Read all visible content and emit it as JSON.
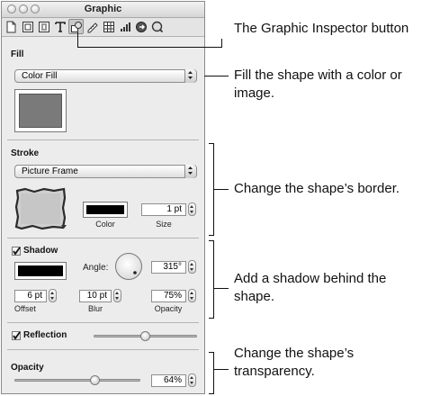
{
  "window": {
    "title": "Graphic",
    "toolbar_icons": [
      "document-icon",
      "layout-icon",
      "wrap-icon",
      "text-icon",
      "graphic-icon",
      "metrics-icon",
      "table-icon",
      "chart-icon",
      "hyperlink-icon",
      "quicktime-icon"
    ],
    "selected_tool": "graphic-icon"
  },
  "fill": {
    "label": "Fill",
    "type": "Color Fill",
    "color": "#7a7a7a"
  },
  "stroke": {
    "label": "Stroke",
    "type": "Picture Frame",
    "color": "#000000",
    "color_label": "Color",
    "size_value": "1 pt",
    "size_label": "Size"
  },
  "shadow": {
    "label": "Shadow",
    "checked": true,
    "color": "#000000",
    "angle_label": "Angle:",
    "angle_value": "315°",
    "offset_value": "6 pt",
    "offset_label": "Offset",
    "blur_value": "10 pt",
    "blur_label": "Blur",
    "opacity_value": "75%",
    "opacity_label": "Opacity"
  },
  "reflection": {
    "label": "Reflection",
    "checked": true,
    "level": 0.5
  },
  "opacity": {
    "label": "Opacity",
    "value": "64%",
    "level": 0.64
  },
  "callouts": {
    "inspector_button": "The Graphic Inspector button",
    "fill": "Fill the shape with a color or image.",
    "stroke": "Change the shape’s border.",
    "shadow": "Add a shadow behind the shape.",
    "opacity": "Change the shape’s transparency."
  }
}
